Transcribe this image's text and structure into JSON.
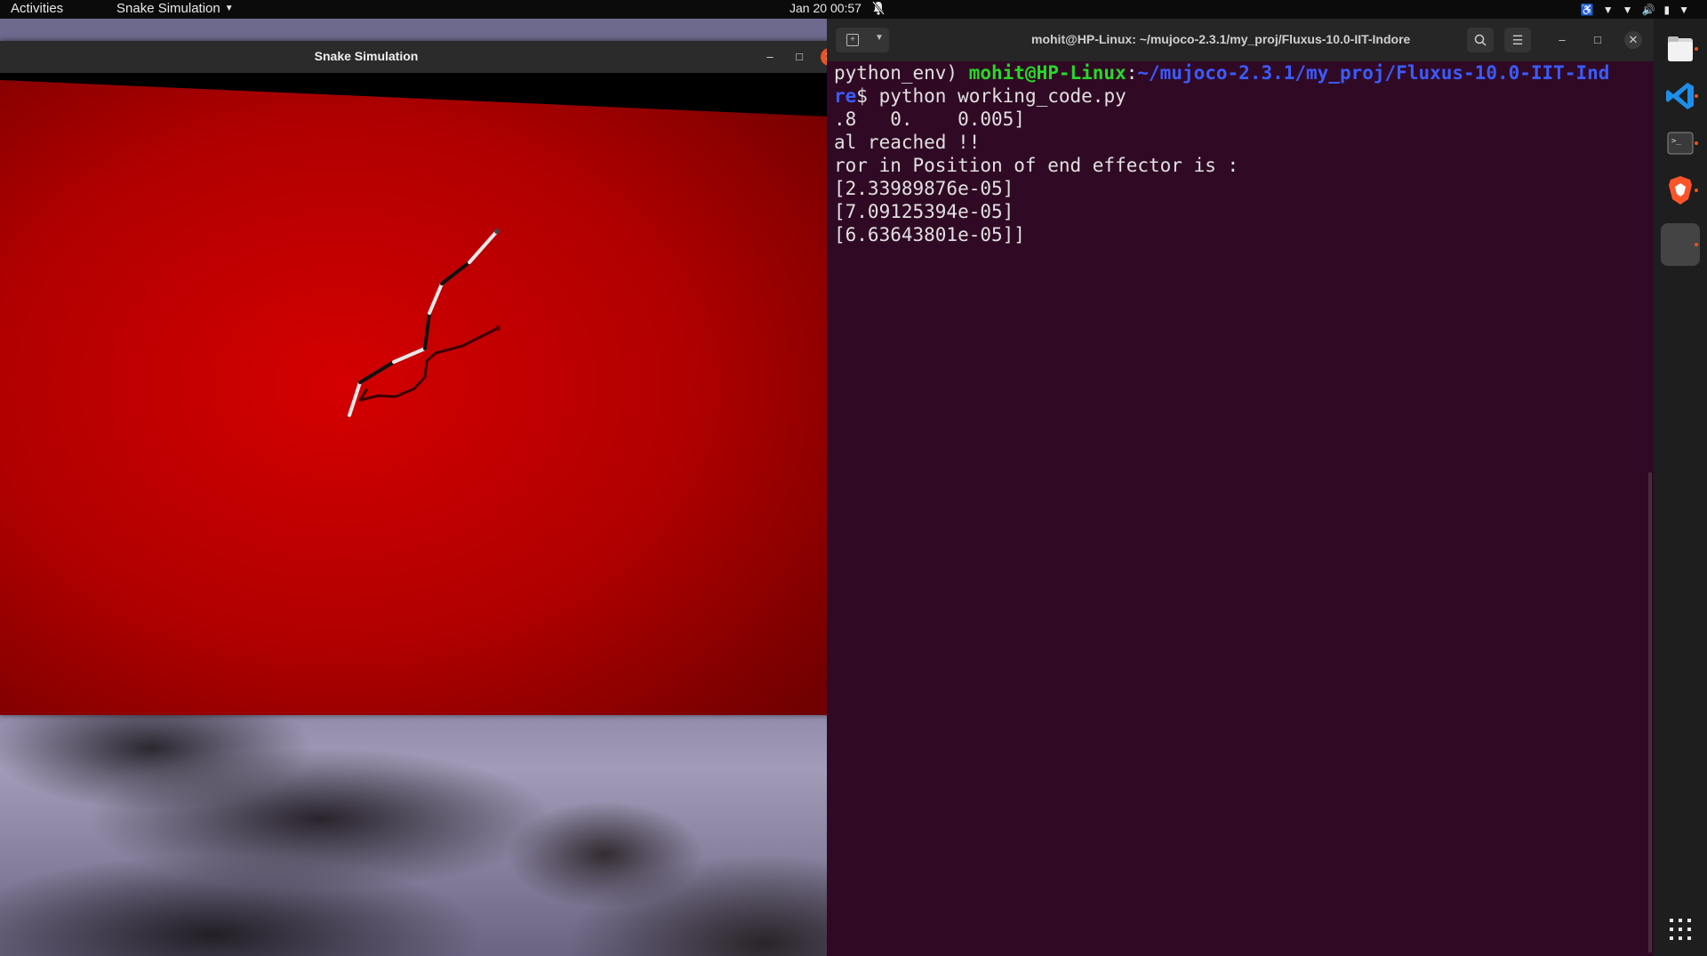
{
  "topbar": {
    "activities": "Activities",
    "app_menu": "Snake Simulation",
    "date": "Jan 20",
    "time": "00:57"
  },
  "sim_window": {
    "title": "Snake Simulation",
    "floor_color": "#c40000"
  },
  "terminal": {
    "title": "mohit@HP-Linux: ~/mujoco-2.3.1/my_proj/Fluxus-10.0-IIT-Indore",
    "prompt_env": "python_env) ",
    "prompt_user": "mohit@HP-Linux",
    "prompt_colon": ":",
    "prompt_path": "~/mujoco-2.3.1/my_proj/Fluxus-10.0-IIT-Ind",
    "prompt_cont": "re",
    "prompt_dollar": "$ ",
    "command": "python working_code.py",
    "output_lines": [
      ".8   0.    0.005]",
      "al reached !!",
      "ror in Position of end effector is :",
      "[2.33989876e-05]",
      "[7.09125394e-05]",
      "[6.63643801e-05]]"
    ]
  },
  "dock": {
    "items": [
      "files-icon",
      "vscode-icon",
      "terminal-icon",
      "brave-icon",
      "simulation-window-icon"
    ],
    "show_apps": "show-apps-icon"
  }
}
